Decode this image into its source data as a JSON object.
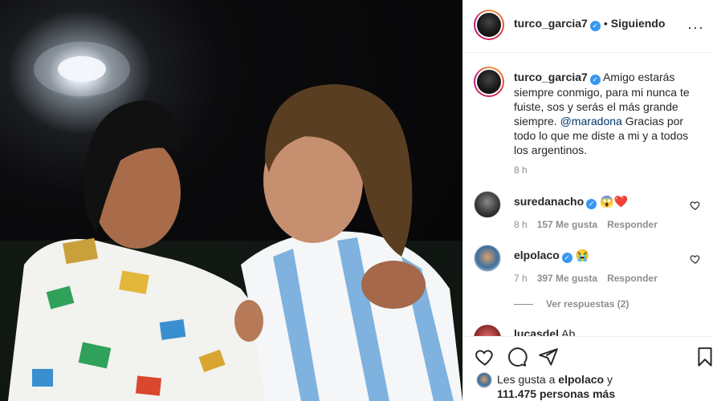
{
  "post": {
    "username": "turco_garcia7",
    "follow_status": "Siguiendo",
    "caption_text_1": "Amigo estarás siempre conmigo, para mi nunca te fuiste, sos y serás el más grande siempre. ",
    "caption_mention": "@maradona",
    "caption_text_2": " Gracias por todo lo que me diste a mi y a todos los argentinos.",
    "caption_time": "8 h"
  },
  "comments": [
    {
      "username": "suredanacho",
      "emoji": "😱❤️",
      "time": "8 h",
      "likes": "157 Me gusta",
      "reply": "Responder"
    },
    {
      "username": "elpolaco",
      "emoji": "😭",
      "time": "7 h",
      "likes": "397 Me gusta",
      "reply": "Responder",
      "view_replies": "Ver respuestas (2)"
    },
    {
      "username": "lucasdel",
      "text_partial": "Ab"
    }
  ],
  "likes_summary": {
    "prefix": "Les gusta a",
    "user": "elpolaco",
    "suffix": "y",
    "count": "111.475 personas más"
  },
  "icons": [
    "heart-icon",
    "comment-icon",
    "share-icon",
    "bookmark-icon",
    "verified-icon"
  ],
  "colors": {
    "verified": "#3897f0",
    "mention": "#00376b",
    "heart_red": "#ed4956"
  }
}
